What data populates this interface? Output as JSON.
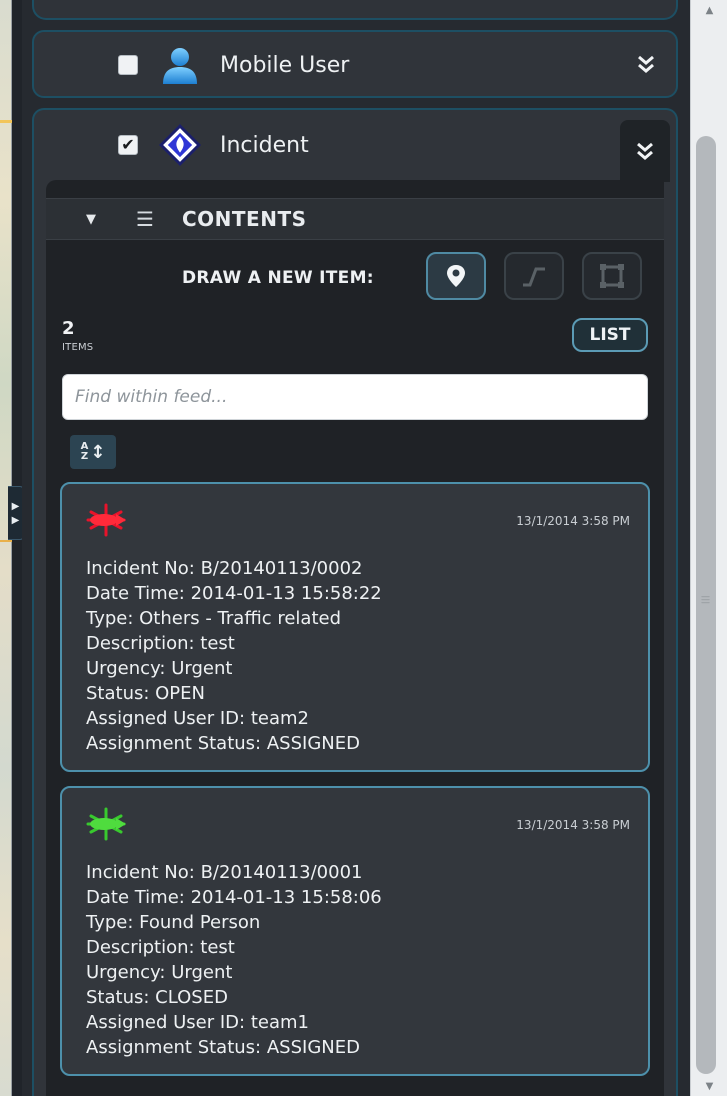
{
  "colors": {
    "accent": "#4d90ab",
    "panel": "#30343a",
    "card": "#33373d"
  },
  "groups": [
    {
      "title": "Mobile User",
      "checked": false,
      "icon": "person-icon",
      "toggle_icon": "double-chevron-down-icon"
    },
    {
      "title": "Incident",
      "checked": true,
      "icon": "incident-diamond-icon",
      "toggle_icon": "double-chevron-down-icon"
    }
  ],
  "contents": {
    "title": "CONTENTS",
    "draw_label": "DRAW A NEW ITEM:",
    "draw_tools": [
      "map-pin-icon",
      "polyline-icon",
      "polygon-icon"
    ],
    "count": "2",
    "count_label": "ITEMS",
    "list_button": "LIST",
    "search_placeholder": "Find within feed...",
    "sort_label": "A Z",
    "items": [
      {
        "icon": "red-incident-marker-icon",
        "time": "13/1/2014 3:58 PM",
        "lines": [
          "Incident No: B/20140113/0002",
          "Date Time: 2014-01-13 15:58:22",
          "Type: Others - Traffic related",
          "Description: test",
          "Urgency: Urgent",
          "Status: OPEN",
          "Assigned User ID: team2",
          "Assignment Status: ASSIGNED"
        ]
      },
      {
        "icon": "green-incident-marker-icon",
        "time": "13/1/2014 3:58 PM",
        "lines": [
          "Incident No: B/20140113/0001",
          "Date Time: 2014-01-13 15:58:06",
          "Type: Found Person",
          "Description: test",
          "Urgency: Urgent",
          "Status: CLOSED",
          "Assigned User ID: team1",
          "Assignment Status: ASSIGNED"
        ]
      }
    ]
  }
}
